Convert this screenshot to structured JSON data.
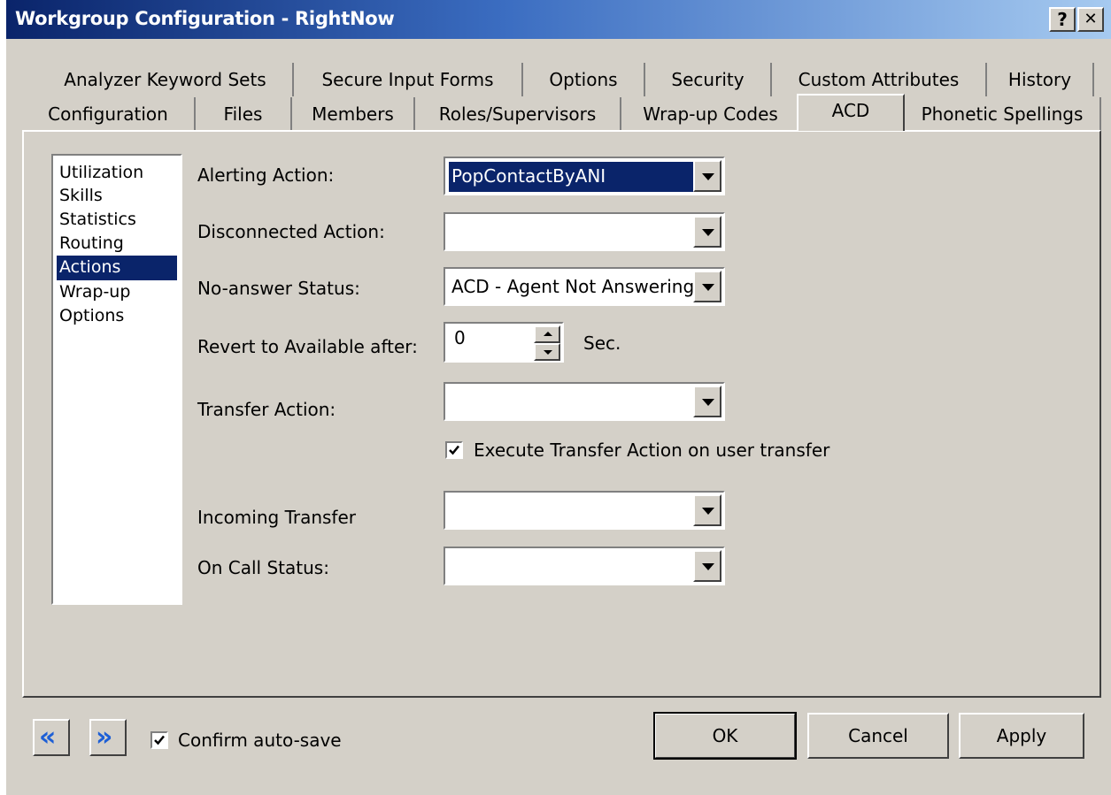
{
  "window": {
    "title": "Workgroup Configuration - RightNow",
    "help_label": "?",
    "close_label": "✕"
  },
  "tabs_row1": [
    {
      "label": "Analyzer Keyword Sets"
    },
    {
      "label": "Secure Input Forms"
    },
    {
      "label": "Options"
    },
    {
      "label": "Security"
    },
    {
      "label": "Custom Attributes"
    },
    {
      "label": "History"
    }
  ],
  "tabs_row2": [
    {
      "label": "Configuration"
    },
    {
      "label": "Files"
    },
    {
      "label": "Members"
    },
    {
      "label": "Roles/Supervisors"
    },
    {
      "label": "Wrap-up Codes"
    },
    {
      "label": "ACD",
      "active": true
    },
    {
      "label": "Phonetic Spellings"
    }
  ],
  "sections": [
    {
      "label": "Utilization"
    },
    {
      "label": "Skills"
    },
    {
      "label": "Statistics"
    },
    {
      "label": "Routing"
    },
    {
      "label": "Actions",
      "selected": true
    },
    {
      "label": "Wrap-up"
    },
    {
      "label": "Options"
    }
  ],
  "form": {
    "alerting_label": "Alerting Action:",
    "alerting_value": "PopContactByANI",
    "disconnected_label": "Disconnected Action:",
    "disconnected_value": "",
    "noanswer_label": "No-answer Status:",
    "noanswer_value": "ACD - Agent Not Answering",
    "revert_label": "Revert to Available after:",
    "revert_value": "0",
    "revert_unit": "Sec.",
    "transfer_label": "Transfer Action:",
    "transfer_value": "",
    "execute_transfer_label": "Execute Transfer Action on user transfer",
    "execute_transfer_checked": true,
    "incoming_label": "Incoming Transfer",
    "incoming_value": "",
    "oncall_label": "On Call Status:",
    "oncall_value": ""
  },
  "footer": {
    "prev_icon": "double-chevron-left-icon",
    "next_icon": "double-chevron-right-icon",
    "confirm_label": "Confirm auto-save",
    "confirm_checked": true,
    "ok_label": "OK",
    "cancel_label": "Cancel",
    "apply_label": "Apply"
  }
}
